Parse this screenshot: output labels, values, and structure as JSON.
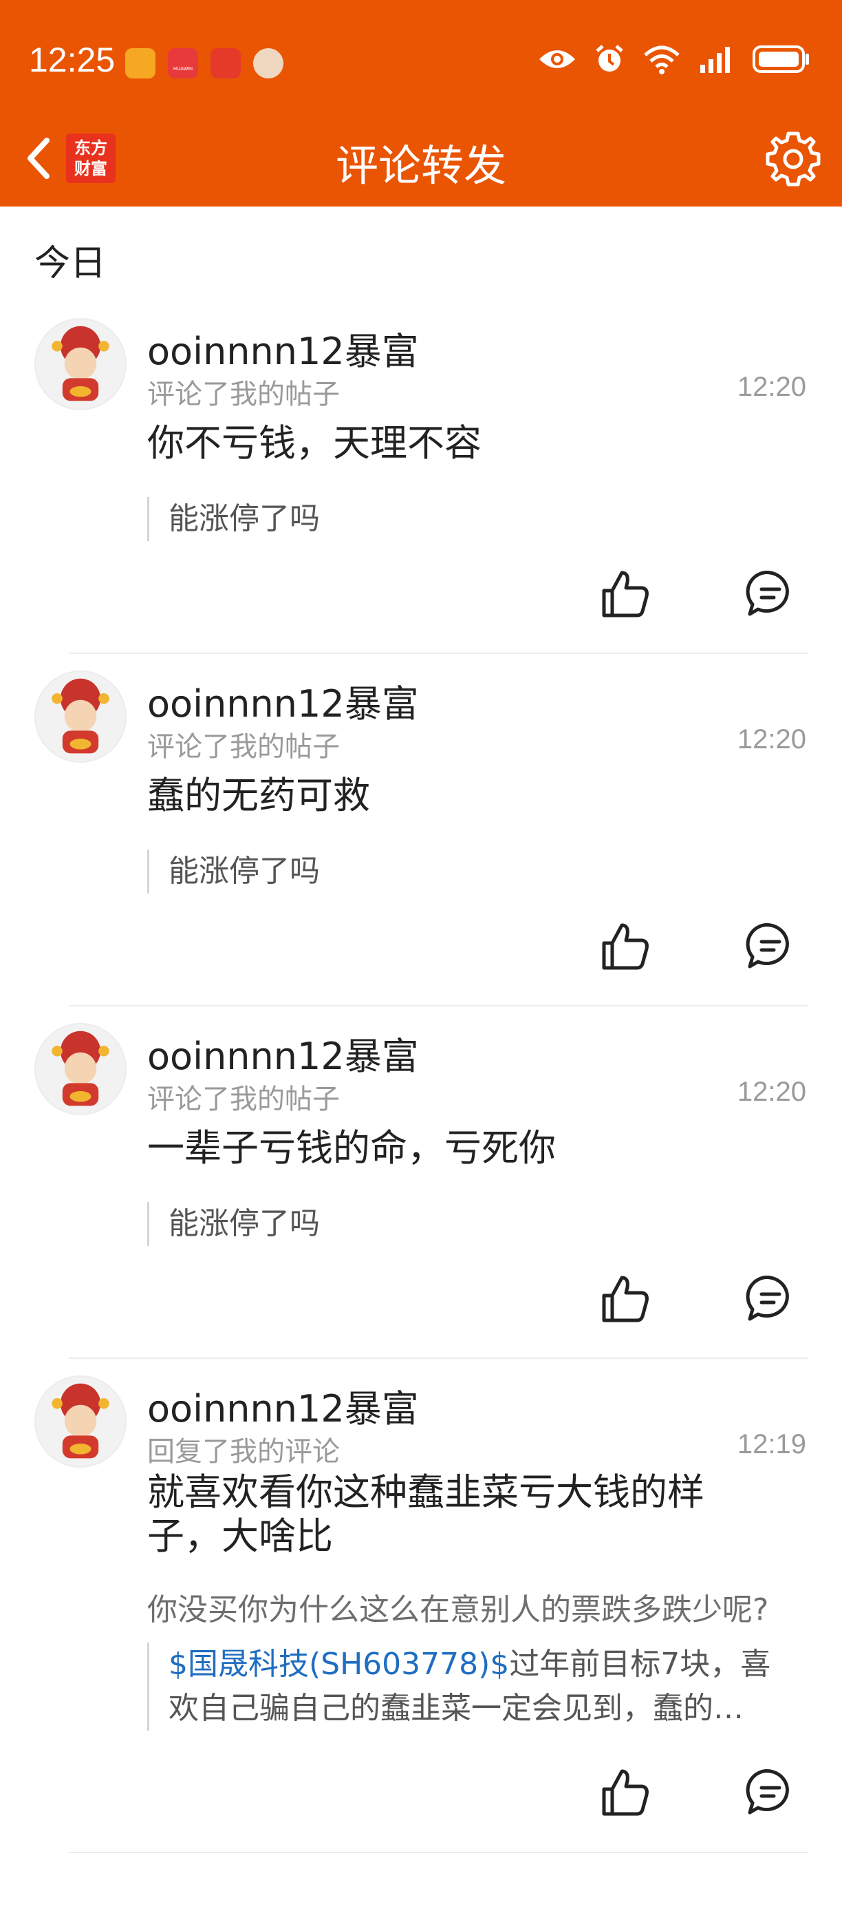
{
  "status_bar": {
    "time": "12:25",
    "huawei_label": "HUAWEI"
  },
  "nav": {
    "title": "评论转发",
    "brand_line1": "东方",
    "brand_line2": "财富"
  },
  "section_label": "今日",
  "items": [
    {
      "name": "ooinnnn12暴富",
      "action": "评论了我的帖子",
      "time": "12:20",
      "content": "你不亏钱，天理不容",
      "quote": "能涨停了吗"
    },
    {
      "name": "ooinnnn12暴富",
      "action": "评论了我的帖子",
      "time": "12:20",
      "content": "蠢的无药可救",
      "quote": "能涨停了吗"
    },
    {
      "name": "ooinnnn12暴富",
      "action": "评论了我的帖子",
      "time": "12:20",
      "content": "一辈子亏钱的命，亏死你",
      "quote": "能涨停了吗"
    },
    {
      "name": "ooinnnn12暴富",
      "action": "回复了我的评论",
      "time": "12:19",
      "content": "就喜欢看你这种蠢韭菜亏大钱的样子，大啥比",
      "original": "你没买你为什么这么在意别人的票跌多跌少呢?",
      "quote_stock": "$国晟科技(SH603778)$",
      "quote": "过年前目标7块，喜欢自己骗自己的蠢韭菜一定会见到，蠢的…"
    }
  ],
  "colors": {
    "header_bg": "#EA5504",
    "stock_link": "#1F6DC1"
  }
}
